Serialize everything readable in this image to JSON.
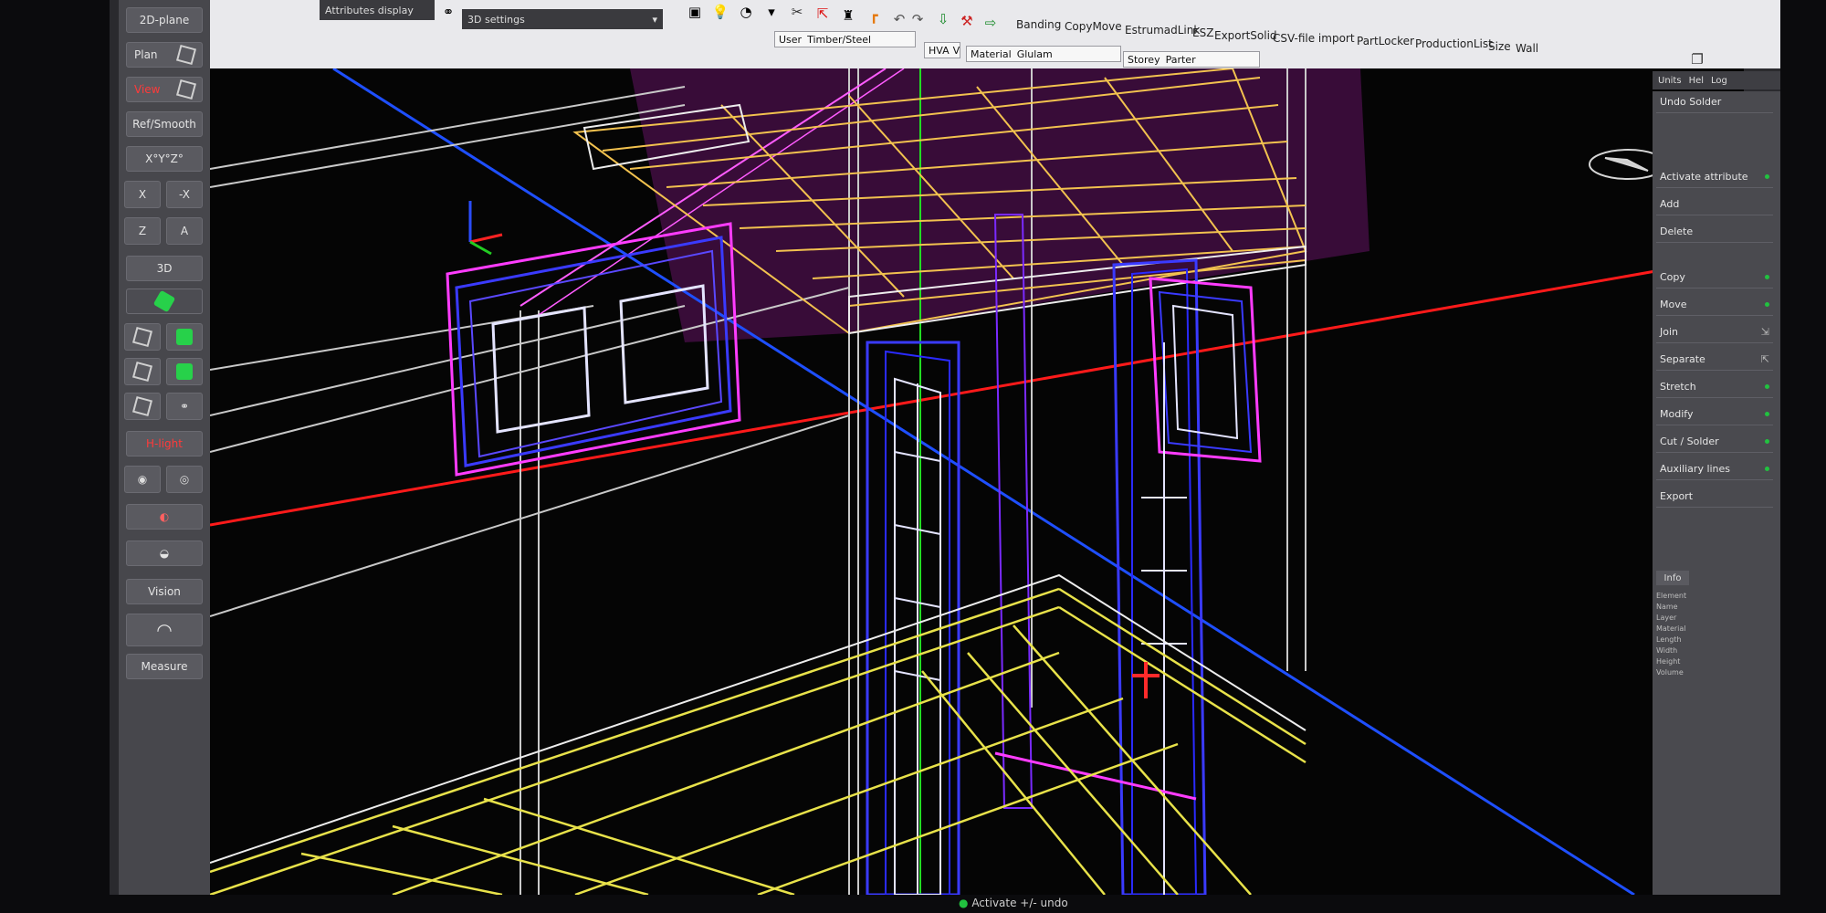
{
  "left_toolbar": {
    "btn_2d_plane": "2D-plane",
    "btn_plan": "Plan",
    "btn_view": "View",
    "btn_reflsmooth": "Ref/Smooth",
    "btn_angles": "X°Y°Z°",
    "btn_x": "X",
    "btn_neg_x": "-X",
    "btn_z": "Z",
    "btn_a": "A",
    "btn_3d": "3D",
    "btn_highlight": "H-light",
    "btn_vision": "Vision",
    "btn_measure": "Measure"
  },
  "top_toolbar": {
    "attributes_display": "Attributes display",
    "settings_3d": "3D settings",
    "user_label": "User",
    "user_value": "Timber/Steel",
    "hva_label": "HVA",
    "hva_value": "V",
    "material_label": "Material",
    "material_value": "Glulam",
    "storey_label": "Storey",
    "storey_value": "Parter",
    "menu": {
      "banding": "Banding",
      "copymove": "CopyMove",
      "estrumadlink": "EstrumadLink",
      "esz": "ESZ",
      "exportsolid": "ExportSolid",
      "csv_import": "CSV-file import",
      "partlocker": "PartLocker",
      "productionlist": "ProductionList",
      "size": "Size",
      "wall": "Wall"
    }
  },
  "right_panel": {
    "tabs": {
      "units": "Units",
      "help": "Hel",
      "log": "Log"
    },
    "undo_solder": "Undo Solder",
    "items": {
      "activate_attribute": "Activate attribute",
      "add": "Add",
      "delete": "Delete",
      "copy": "Copy",
      "move": "Move",
      "join": "Join",
      "separate": "Separate",
      "stretch": "Stretch",
      "modify": "Modify",
      "cut_solder": "Cut / Solder",
      "auxiliary_lines": "Auxiliary lines",
      "export": "Export"
    },
    "info_tab": "Info",
    "info_lines": {
      "l1": "Element",
      "l2": "Name",
      "l3": "Layer",
      "l4": "Material",
      "l5": "Length",
      "l6": "Width",
      "l7": "Height",
      "l8": "Volume"
    }
  },
  "status": {
    "activate_undo": "Activate +/- undo"
  },
  "colors": {
    "timber": "#e8e24a",
    "roof": "#f2c24f",
    "wall_frame": "#ff3cff",
    "opening": "#3a3aff",
    "axis_x": "#ff1a1a",
    "axis_y": "#1e4fff",
    "axis_z": "#22dd22"
  }
}
